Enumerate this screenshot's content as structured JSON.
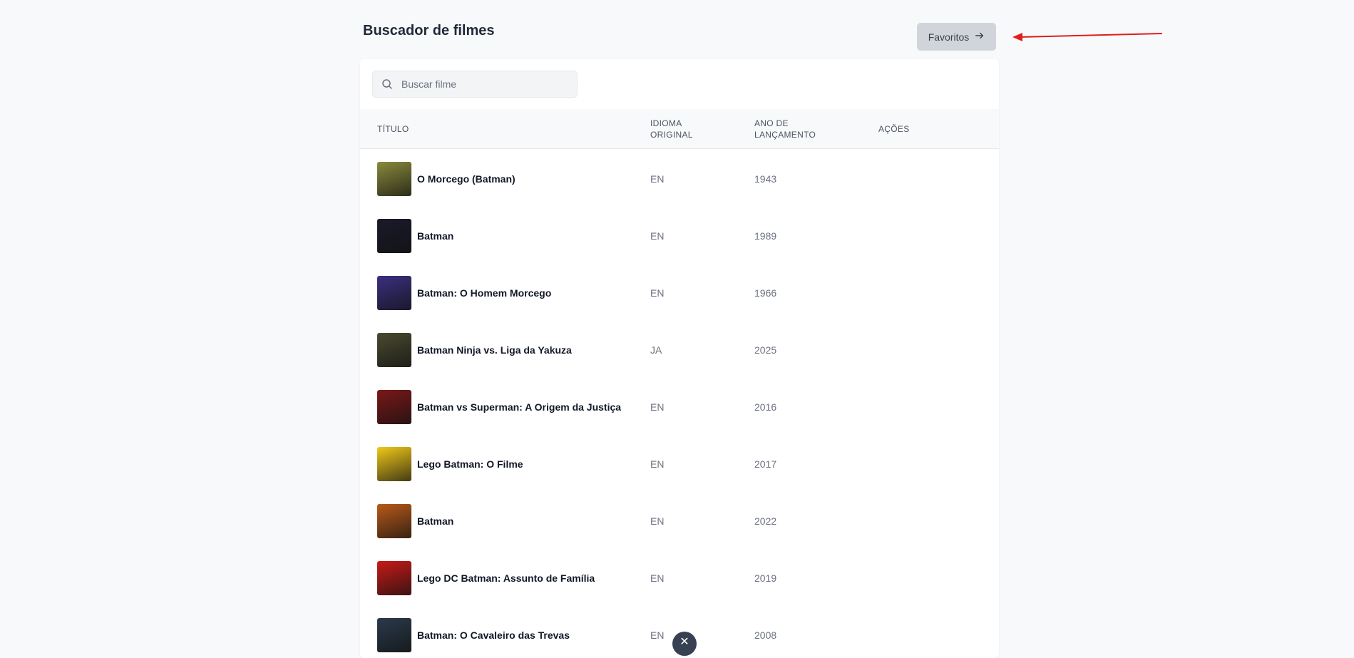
{
  "header": {
    "title": "Buscador de filmes",
    "favorites_label": "Favoritos"
  },
  "search": {
    "placeholder": "Buscar filme",
    "value": ""
  },
  "table": {
    "columns": {
      "title": "Título",
      "language": "Idioma original",
      "year": "Ano de lançamento",
      "actions": "Ações"
    },
    "rows": [
      {
        "title": "O Morcego (Batman)",
        "language": "EN",
        "year": "1943"
      },
      {
        "title": "Batman",
        "language": "EN",
        "year": "1989"
      },
      {
        "title": "Batman: O Homem Morcego",
        "language": "EN",
        "year": "1966"
      },
      {
        "title": "Batman Ninja vs. Liga da Yakuza",
        "language": "JA",
        "year": "2025"
      },
      {
        "title": "Batman vs Superman: A Origem da Justiça",
        "language": "EN",
        "year": "2016"
      },
      {
        "title": "Lego Batman: O Filme",
        "language": "EN",
        "year": "2017"
      },
      {
        "title": "Batman",
        "language": "EN",
        "year": "2022"
      },
      {
        "title": "Lego DC Batman: Assunto de Família",
        "language": "EN",
        "year": "2019"
      },
      {
        "title": "Batman: O Cavaleiro das Trevas",
        "language": "EN",
        "year": "2008"
      }
    ]
  },
  "icons": {
    "search": "search-icon",
    "arrow": "arrow-right-icon",
    "annotation": "red-annotation-arrow",
    "close": "close-icon"
  },
  "colors": {
    "button_bg": "#d1d5db",
    "annotation": "#e11d1d",
    "poster_colors": [
      "#8a8a3c",
      "#1a1a2a",
      "#3a3080",
      "#4a4a30",
      "#7a1818",
      "#f0c81a",
      "#b85a18",
      "#c81a18",
      "#2a3a4a"
    ]
  }
}
